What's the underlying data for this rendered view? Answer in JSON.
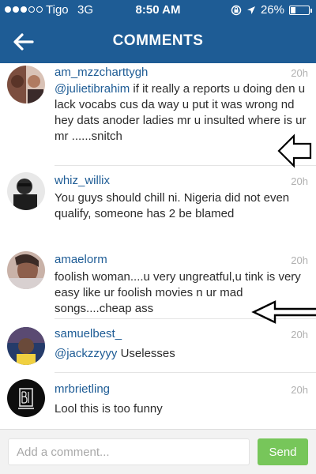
{
  "status_bar": {
    "carrier": "Tigo",
    "network": "3G",
    "time": "8:50 AM",
    "battery_percent": "26%",
    "battery_level": 0.26,
    "signal_bars_filled": 3,
    "signal_bars_total": 5
  },
  "nav": {
    "title": "COMMENTS"
  },
  "comments": [
    {
      "username": "am_mzzcharttygh",
      "time": "20h",
      "mention": "@julietibrahim",
      "text": " if it really a reports u doing den u lack vocabs cus da way u put it was wrong nd hey dats  anoder ladies mr u insulted where is ur mr ......snitch"
    },
    {
      "username": "whiz_willix",
      "time": "20h",
      "mention": "",
      "text": "You guys should chill ni. Nigeria did not even qualify, someone has 2 be blamed"
    },
    {
      "username": "amaelorm",
      "time": "20h",
      "mention": "",
      "text": "foolish woman....u very ungreatful,u tink is very easy like ur foolish movies n ur mad songs....cheap ass"
    },
    {
      "username": "samuelbest_",
      "time": "20h",
      "mention": "@jackzzyyy",
      "text": " Uselesses"
    },
    {
      "username": "mrbrietling",
      "time": "20h",
      "mention": "",
      "text": "Lool this is too funny"
    }
  ],
  "composer": {
    "placeholder": "Add a comment...",
    "send_label": "Send"
  },
  "colors": {
    "header": "#1e5c95",
    "username": "#1e5c95",
    "send_button": "#77c65a"
  }
}
